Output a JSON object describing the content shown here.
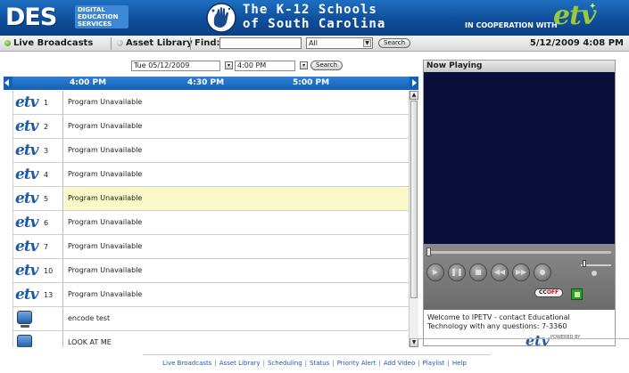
{
  "header": {
    "logo_text": "DES",
    "logo_sub": "DIGITAL EDUCATION SERVICES",
    "title_line1": "The K-12 Schools",
    "title_line2": "of South Carolina",
    "cooperation": "IN COOPERATION WITH",
    "partner_logo": "etv"
  },
  "toolbar": {
    "tabs": [
      {
        "label": "Live Broadcasts",
        "icon": "green-dot-icon"
      },
      {
        "label": "Asset Library",
        "icon": "gray-dot-icon"
      }
    ],
    "find_label": "Find:",
    "find_value": "",
    "select_value": "All",
    "search_label": "Search",
    "datetime": "5/12/2009 4:08 PM"
  },
  "schedule": {
    "date_value": "Tue 05/12/2009",
    "time_value": "4:00 PM",
    "search_label": "Search",
    "time_slots": [
      "4:00 PM",
      "4:30 PM",
      "5:00 PM"
    ],
    "rows": [
      {
        "channel": "1",
        "program": "Program Unavailable",
        "icon": "etv"
      },
      {
        "channel": "2",
        "program": "Program Unavailable",
        "icon": "etv"
      },
      {
        "channel": "3",
        "program": "Program Unavailable",
        "icon": "etv"
      },
      {
        "channel": "4",
        "program": "Program Unavailable",
        "icon": "etv"
      },
      {
        "channel": "5",
        "program": "Program Unavailable",
        "icon": "etv",
        "highlight": true
      },
      {
        "channel": "6",
        "program": "Program Unavailable",
        "icon": "etv"
      },
      {
        "channel": "7",
        "program": "Program Unavailable",
        "icon": "etv"
      },
      {
        "channel": "10",
        "program": "Program Unavailable",
        "icon": "etv"
      },
      {
        "channel": "13",
        "program": "Program Unavailable",
        "icon": "etv"
      },
      {
        "channel": "",
        "program": "encode test",
        "icon": "computer"
      },
      {
        "channel": "",
        "program": "LOOK AT ME",
        "icon": "computer"
      }
    ]
  },
  "now_playing": {
    "title": "Now Playing",
    "cc_label": "CC",
    "cc_state": "OFF",
    "welcome": "Welcome to IPETV - contact Educational Technology with any questions: 7-3360",
    "etv_logo": "etv",
    "powered_by": "POWERED BY"
  },
  "footer": {
    "links": [
      "Live Broadcasts",
      "Asset Library",
      "Scheduling",
      "Status",
      "Priority Alert",
      "Add Video",
      "Playlist",
      "Help"
    ]
  },
  "colors": {
    "header_blue": "#0f4f9c",
    "etv_green": "#9ac93a",
    "video_bg": "#0b0e3a",
    "highlight_row": "#fbf8c8"
  }
}
